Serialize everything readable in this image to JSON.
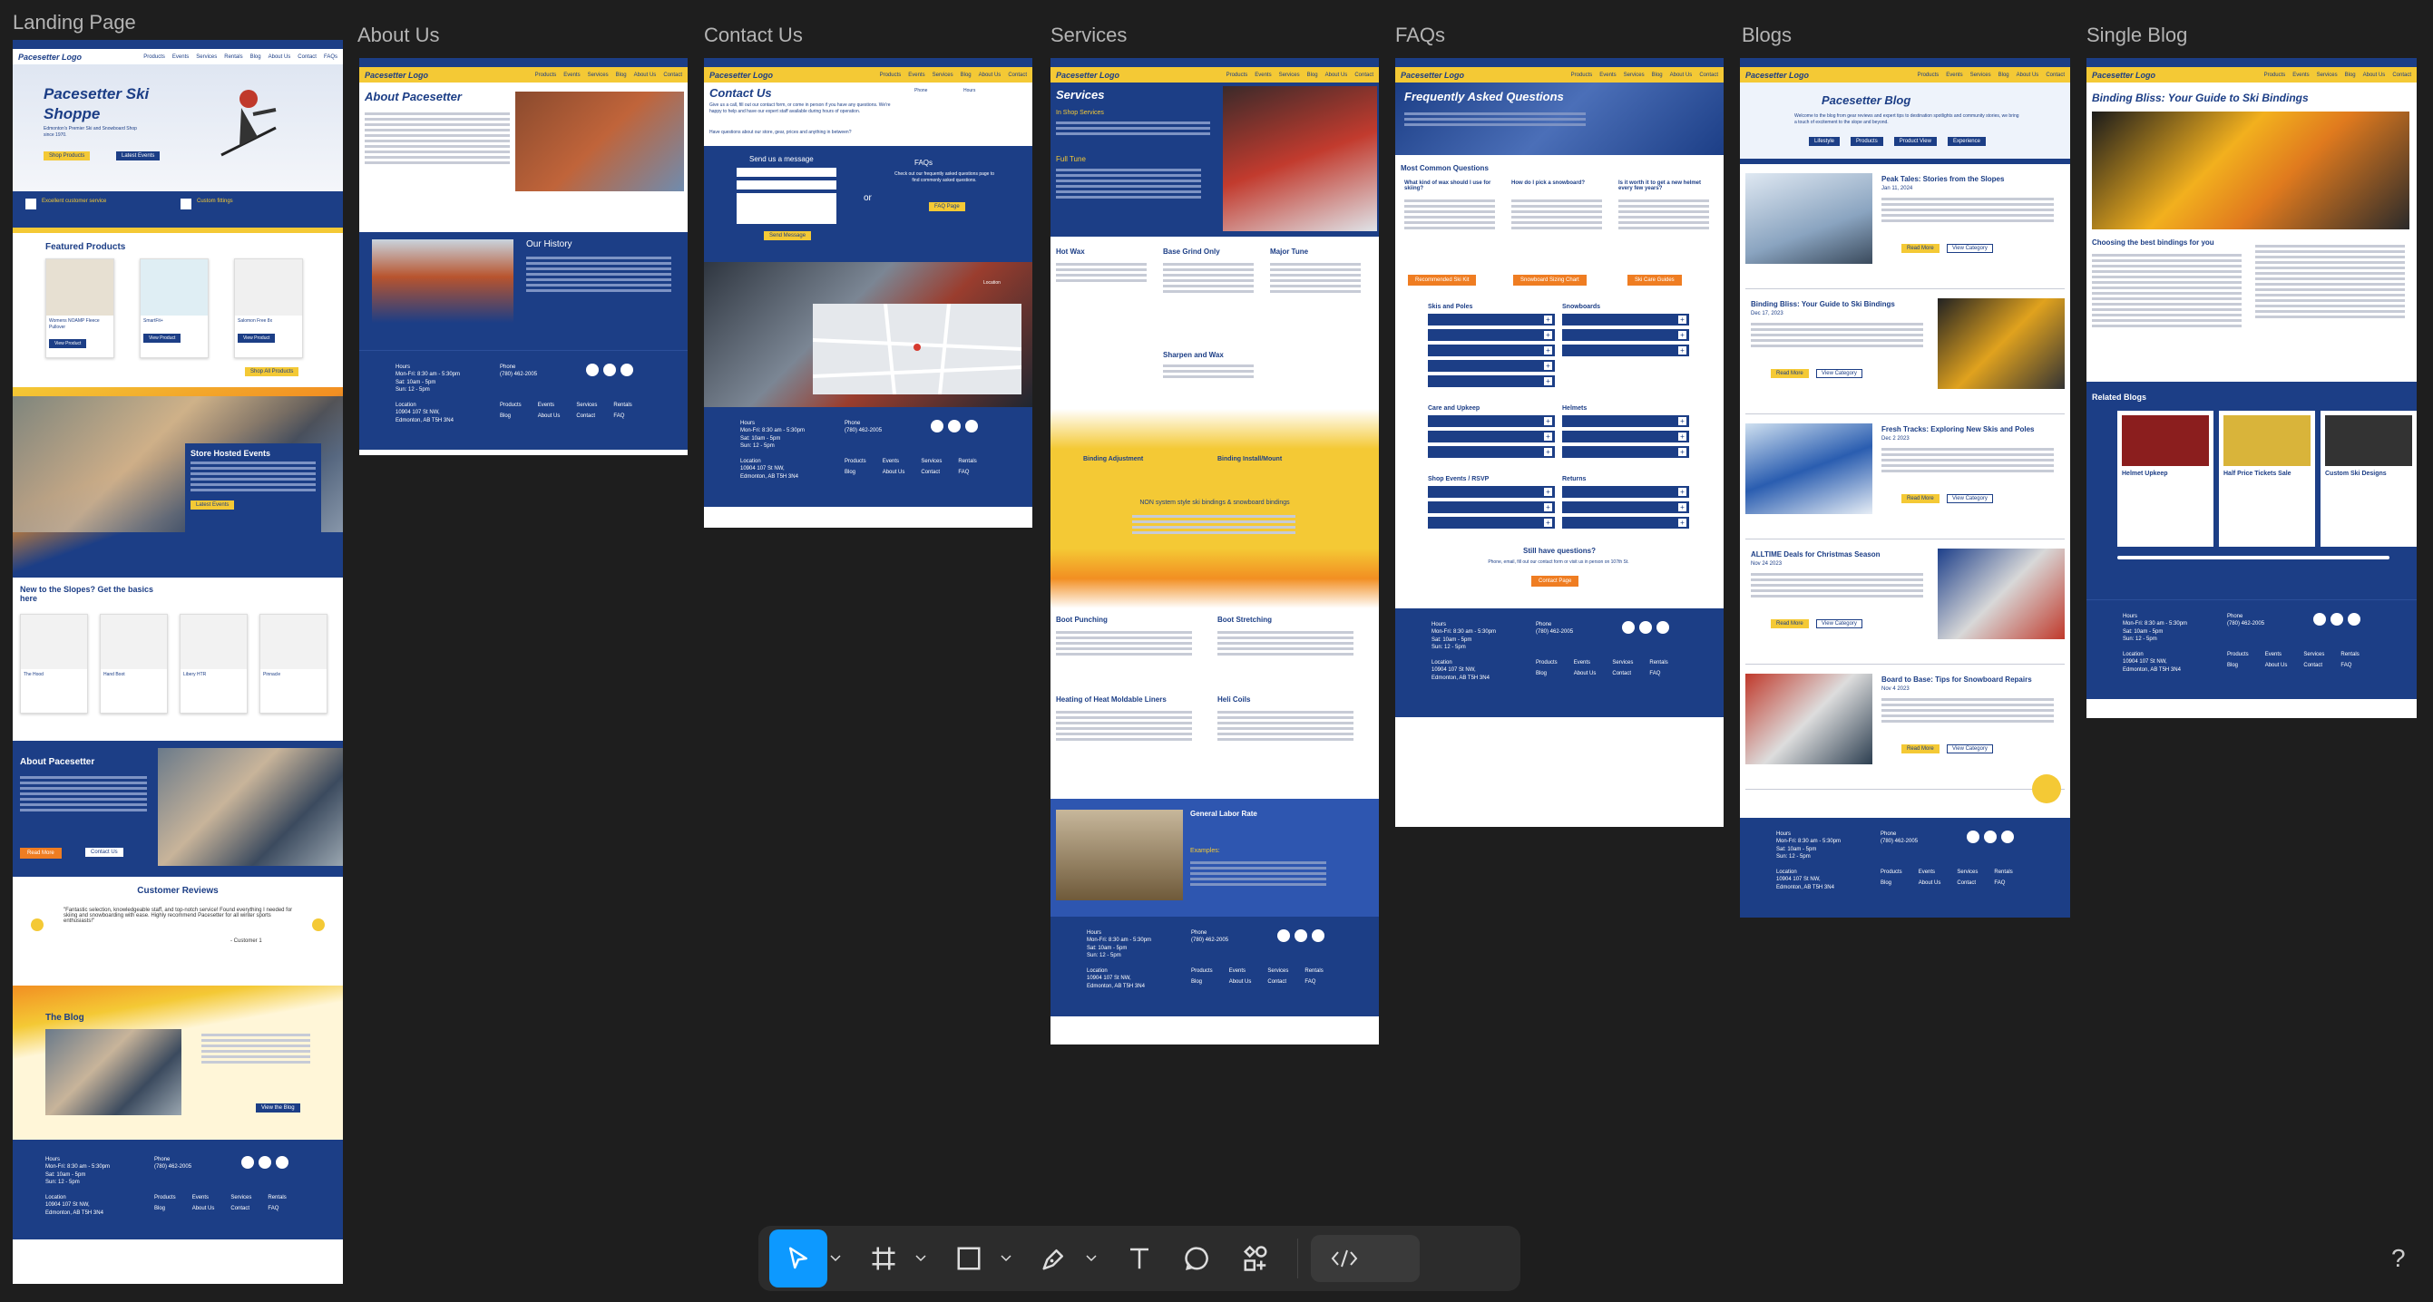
{
  "frames": {
    "landing": {
      "label": "Landing Page"
    },
    "about": {
      "label": "About Us"
    },
    "contact": {
      "label": "Contact Us"
    },
    "services": {
      "label": "Services"
    },
    "faqs": {
      "label": "FAQs"
    },
    "blogs": {
      "label": "Blogs"
    },
    "single_blog": {
      "label": "Single Blog"
    }
  },
  "nav": {
    "logo": "Pacesetter Logo",
    "links": [
      "Products",
      "Events",
      "Services",
      "Rentals",
      "Blog",
      "About Us",
      "Contact",
      "FAQs"
    ]
  },
  "landing": {
    "hero_title": "Pacesetter Ski Shoppe",
    "hero_sub": "Edmonton's Premier Ski and Snowboard Shop since 1970.",
    "btn_shop": "Shop Products",
    "btn_events": "Latest Events",
    "feat1": "Excellent customer service",
    "feat2": "Custom fittings",
    "featured_title": "Featured Products",
    "products": [
      "Womens NOAMP Fleece Pullover",
      "SmartFit+",
      "Elan Ripstick 94",
      "Salomon Free 8x"
    ],
    "view_product": "View Product",
    "shop_all": "Shop All Products",
    "events_title": "Store Hosted Events",
    "events_btn": "Latest Events",
    "new_title": "New to the Slopes? Get the basics here",
    "basics": [
      "The Hood",
      "Hand Boot",
      "Libery HTR",
      "Pinnacle"
    ],
    "about_title": "About Pacesetter",
    "read_more": "Read More",
    "contact_us": "Contact Us",
    "reviews_title": "Customer Reviews",
    "review_text": "\"Fantastic selection, knowledgeable staff, and top-notch service! Found everything I needed for skiing and snowboarding with ease. Highly recommend Pacesetter for all winter sports enthusiasts!\"",
    "review_author": "- Customer 1",
    "blog_title": "The Blog",
    "view_blog": "View the Blog"
  },
  "footer": {
    "hours_label": "Hours",
    "hours": [
      "Mon-Fri: 8:30 am - 5:30pm",
      "Sat: 10am - 5pm",
      "Sun: 12 - 5pm"
    ],
    "phone_label": "Phone",
    "phone": "(780) 462-2005",
    "location_label": "Location",
    "address": [
      "10904 107 St NW,",
      "Edmonton, AB T5H 3N4"
    ],
    "links": [
      "Products",
      "Events",
      "Services",
      "Rentals",
      "Blog",
      "About Us",
      "Contact",
      "FAQ"
    ]
  },
  "about": {
    "title": "About Pacesetter",
    "history_title": "Our History"
  },
  "contact": {
    "title": "Contact Us",
    "intro": "Give us a call, fill out our contact form, or come in person if you have any questions. We're happy to help and have our expert staff available during hours of operation.",
    "intro2": "Have questions about our store, gear, prices and anything in between?",
    "phone_label": "Phone",
    "hours_label": "Hours",
    "form_title": "Send us a message",
    "or": "or",
    "faqs_title": "FAQs",
    "faqs_text": "Check out our frequently asked questions page to find commonly asked questions.",
    "faq_btn": "FAQ Page",
    "send_btn": "Send Message",
    "location_label": "Location"
  },
  "services": {
    "title": "Services",
    "in_shop": "In Shop Services",
    "full_tune": "Full Tune",
    "hot_wax": "Hot Wax",
    "base_grind": "Base Grind Only",
    "major_tune": "Major Tune",
    "sharpen": "Sharpen and Wax",
    "binding_adj": "Binding Adjustment",
    "binding_install": "Binding Install/Mount",
    "non_system": "NON system style ski bindings & snowboard bindings",
    "boot_punching": "Boot Punching",
    "boot_stretching": "Boot Stretching",
    "heat_mold": "Heating of Heat Moldable Liners",
    "heli_coils": "Heli Coils",
    "labor": "General Labor Rate",
    "examples": "Examples:"
  },
  "faqs": {
    "title": "Frequently Asked Questions",
    "common": "Most Common Questions",
    "q1": "What kind of wax should I use for skiing?",
    "q2": "How do I pick a snowboard?",
    "q3": "Is it worth it to get a new helmet every few years?",
    "b1": "Recommended Ski Kit",
    "b2": "Snowboard Sizing Chart",
    "b3": "Ski Care Guides",
    "cat1": "Skis and Poles",
    "cat2": "Snowboards",
    "cat3": "Care and Upkeep",
    "cat4": "Helmets",
    "cat5": "Shop Events / RSVP",
    "cat6": "Returns",
    "still": "Still have questions?",
    "still_sub": "Phone, email, fill out our contact form or visit us in person on 107th St.",
    "contact_btn": "Contact Page"
  },
  "blogs": {
    "title": "Pacesetter Blog",
    "intro": "Welcome to the blog from gear reviews and expert tips to destination spotlights and community stories, we bring a touch of excitement to the slope and beyond.",
    "tags": [
      "Lifestyle",
      "Products",
      "Product View",
      "Experience"
    ],
    "posts": [
      {
        "title": "Peak Tales: Stories from the Slopes",
        "date": "Jan 11, 2024"
      },
      {
        "title": "Binding Bliss: Your Guide to Ski Bindings",
        "date": "Dec 17, 2023"
      },
      {
        "title": "Fresh Tracks: Exploring New Skis and Poles",
        "date": "Dec 2 2023"
      },
      {
        "title": "ALLTIME Deals for Christmas Season",
        "date": "Nov 24 2023"
      },
      {
        "title": "Board to Base: Tips for Snowboard Repairs",
        "date": "Nov 4 2023"
      }
    ],
    "read_more": "Read More",
    "view_category": "View Category"
  },
  "single": {
    "title": "Binding Bliss: Your Guide to Ski Bindings",
    "sub": "Choosing the best bindings for you",
    "related": "Related Blogs",
    "rel": [
      "Helmet Upkeep",
      "Half Price Tickets Sale",
      "Custom Ski Designs"
    ]
  },
  "toolbar": {
    "move": "move-tool",
    "frame": "frame-tool",
    "shape": "rectangle-tool",
    "pen": "pen-tool",
    "text": "text-tool",
    "comment": "comment-tool",
    "assets": "assets-tool",
    "code": "dev-mode",
    "help": "?"
  },
  "colors": {
    "brand_blue": "#1c3e86",
    "brand_yellow": "#f4c935",
    "brand_orange": "#f28f22",
    "canvas": "#1e1e1e",
    "accent": "#0d99ff"
  }
}
